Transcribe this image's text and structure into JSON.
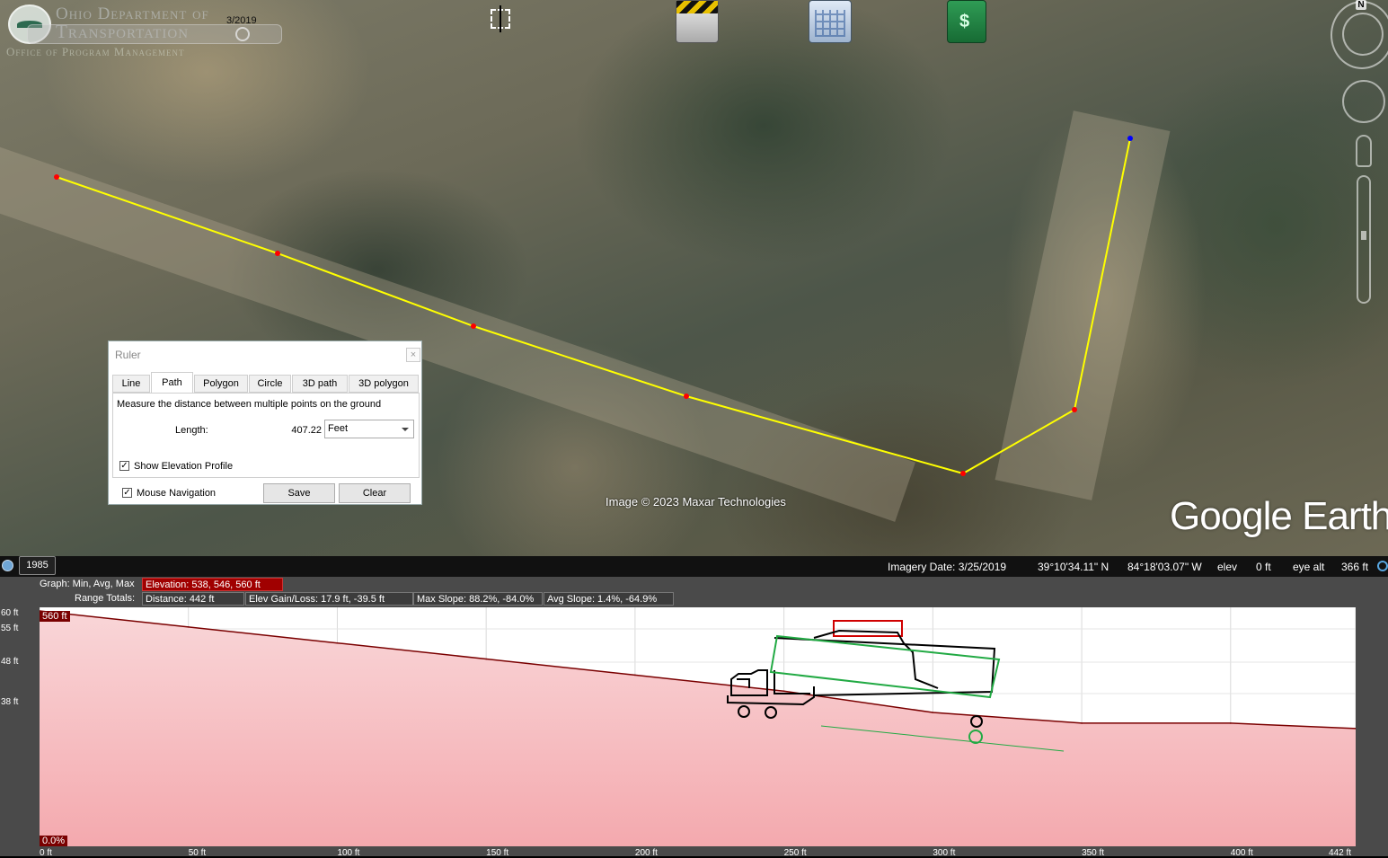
{
  "header": {
    "org_line1": "Ohio Department of",
    "org_line2": "Transportation",
    "org_line3": "Office of Program Management",
    "time_date": "3/2019"
  },
  "toolbar": {
    "icons": [
      "crosshair-icon",
      "clapperboard-icon",
      "calendar-icon",
      "notebook-icon"
    ]
  },
  "navigation": {
    "north_label": "N"
  },
  "map": {
    "attribution": "Image © 2023 Maxar Technologies",
    "watermark": "Google Earth",
    "path_color": "#ffff00",
    "point_color": "#ff0000",
    "end_point_color": "#0000ff"
  },
  "ruler": {
    "title": "Ruler",
    "close": "×",
    "tabs": [
      "Line",
      "Path",
      "Polygon",
      "Circle",
      "3D path",
      "3D polygon"
    ],
    "active_tab": "Path",
    "description": "Measure the distance between multiple points on the ground",
    "length_label": "Length:",
    "length_value": "407.22",
    "unit": "Feet",
    "show_elevation_profile": "Show Elevation Profile",
    "show_elevation_checked": true,
    "mouse_navigation": "Mouse Navigation",
    "mouse_navigation_checked": true,
    "save": "Save",
    "clear": "Clear"
  },
  "status": {
    "year": "1985",
    "imagery_date": "Imagery Date: 3/25/2019",
    "lat": "39°10'34.11\" N",
    "lon": "84°18'03.07\" W",
    "elev_label": "elev",
    "elev_value": "0 ft",
    "eye_alt_label": "eye alt",
    "eye_alt_value": "366 ft"
  },
  "profile": {
    "graph_label": "Graph: Min, Avg, Max",
    "elevation": "Elevation: 538, 546, 560 ft",
    "range_label": "Range Totals:",
    "distance": "Distance: 442 ft",
    "gain_loss": "Elev Gain/Loss: 17.9 ft, -39.5 ft",
    "max_slope": "Max Slope: 88.2%, -84.0%",
    "avg_slope": "Avg Slope: 1.4%, -64.9%",
    "y_ticks": [
      "60 ft",
      "55 ft",
      "48 ft",
      "38 ft"
    ],
    "top_marker": "560 ft",
    "bottom_marker": "0.0%",
    "x_ticks": [
      "0 ft",
      "50 ft",
      "100 ft",
      "150 ft",
      "200 ft",
      "250 ft",
      "300 ft",
      "350 ft",
      "400 ft",
      "442 ft"
    ],
    "fill_color": "#f8c8cc",
    "line_color": "#7a0000"
  },
  "chart_data": {
    "type": "area",
    "title": "",
    "xlabel": "",
    "ylabel": "",
    "x": [
      0,
      50,
      100,
      150,
      200,
      250,
      300,
      350,
      400,
      442
    ],
    "y": [
      560,
      557,
      554,
      551,
      548,
      545,
      541,
      539,
      539,
      538
    ],
    "xlim": [
      0,
      442
    ],
    "x_unit": "ft",
    "y_unit": "ft"
  }
}
